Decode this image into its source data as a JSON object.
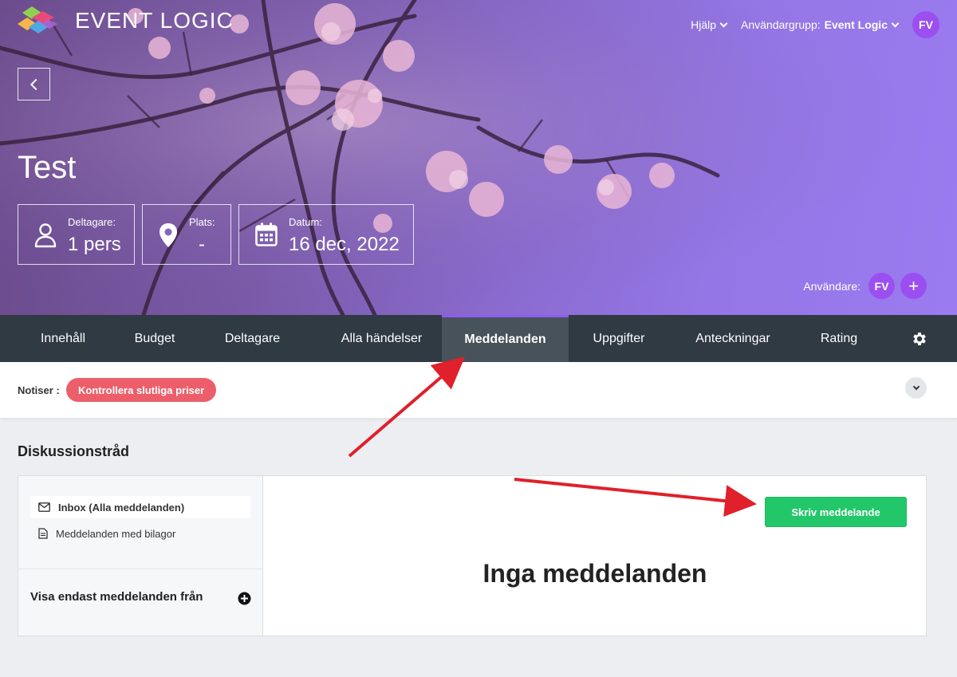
{
  "brand": {
    "name": "EVENT LOGIC"
  },
  "topnav": {
    "help_label": "Hjälp",
    "usergroup_label": "Användargrupp:",
    "usergroup_value": "Event Logic",
    "avatar_initials": "FV"
  },
  "event": {
    "title": "Test",
    "stats": [
      {
        "label": "Deltagare:",
        "value": "1 pers",
        "icon": "person-icon"
      },
      {
        "label": "Plats:",
        "value": "-",
        "icon": "location-pin-icon"
      },
      {
        "label": "Datum:",
        "value": "16 dec, 2022",
        "icon": "calendar-icon"
      }
    ],
    "users_label": "Användare:",
    "user_avatar": "FV",
    "add_user_label": "+"
  },
  "tabs": [
    {
      "label": "Innehåll"
    },
    {
      "label": "Budget"
    },
    {
      "label": "Deltagare"
    },
    {
      "label": "Alla händelser"
    },
    {
      "label": "Meddelanden",
      "active": true
    },
    {
      "label": "Uppgifter"
    },
    {
      "label": "Anteckningar"
    },
    {
      "label": "Rating"
    }
  ],
  "notices": {
    "label": "Notiser :",
    "pill": "Kontrollera slutliga priser"
  },
  "discussion": {
    "title": "Diskussionstråd",
    "sidebar": {
      "items": [
        {
          "label": "Inbox (Alla meddelanden)",
          "icon": "envelope-icon",
          "active": true
        },
        {
          "label": "Meddelanden med bilagor",
          "icon": "document-icon"
        }
      ],
      "filter_label": "Visa endast meddelanden från"
    },
    "write_button": "Skriv meddelande",
    "empty_text": "Inga meddelanden"
  },
  "colors": {
    "accent": "#9b4ff0",
    "tabbar": "#2f3a42",
    "active_tab": "#48525a",
    "notice_pill": "#ec5f6a",
    "primary_button": "#22c76a",
    "annotation_arrow": "#e0202a"
  }
}
